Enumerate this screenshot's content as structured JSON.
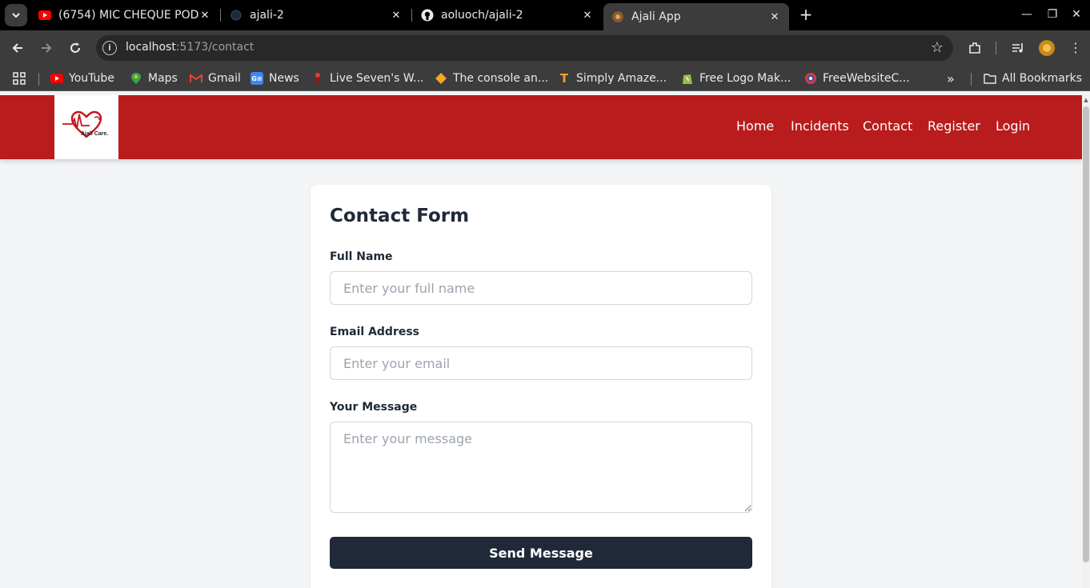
{
  "browser": {
    "tabs": [
      {
        "title": "(6754) MIC CHEQUE POD",
        "favicon": "youtube-icon",
        "active": false
      },
      {
        "title": "ajali-2",
        "favicon": "dark-circle-icon",
        "active": false
      },
      {
        "title": "aoluoch/ajali-2",
        "favicon": "github-icon",
        "active": false
      },
      {
        "title": "Ajali App",
        "favicon": "ajali-app-icon",
        "active": true
      }
    ],
    "url_host": "localhost",
    "url_path": ":5173/contact",
    "bookmarks": [
      {
        "label": "YouTube",
        "icon": "youtube-icon"
      },
      {
        "label": "Maps",
        "icon": "maps-icon"
      },
      {
        "label": "Gmail",
        "icon": "gmail-icon"
      },
      {
        "label": "News",
        "icon": "news-icon"
      },
      {
        "label": "Live Seven's W...",
        "icon": "live-icon"
      },
      {
        "label": "The console an...",
        "icon": "diamond-icon"
      },
      {
        "label": "Simply Amaze...",
        "icon": "t-icon"
      },
      {
        "label": "Free Logo Mak...",
        "icon": "shopify-icon"
      },
      {
        "label": "FreeWebsiteC...",
        "icon": "globe-icon"
      }
    ],
    "more_bookmarks": "»",
    "all_bookmarks": "All Bookmarks"
  },
  "app": {
    "logo_text": "Ajali Care.",
    "nav": [
      "Home",
      "Incidents",
      "Contact",
      "Register",
      "Login"
    ],
    "colors": {
      "nav_bg": "#b91c1c",
      "button_bg": "#1f2937",
      "page_bg": "#f3f4f6"
    }
  },
  "form": {
    "title": "Contact Form",
    "name_label": "Full Name",
    "name_placeholder": "Enter your full name",
    "email_label": "Email Address",
    "email_placeholder": "Enter your email",
    "message_label": "Your Message",
    "message_placeholder": "Enter your message",
    "submit_label": "Send Message"
  }
}
